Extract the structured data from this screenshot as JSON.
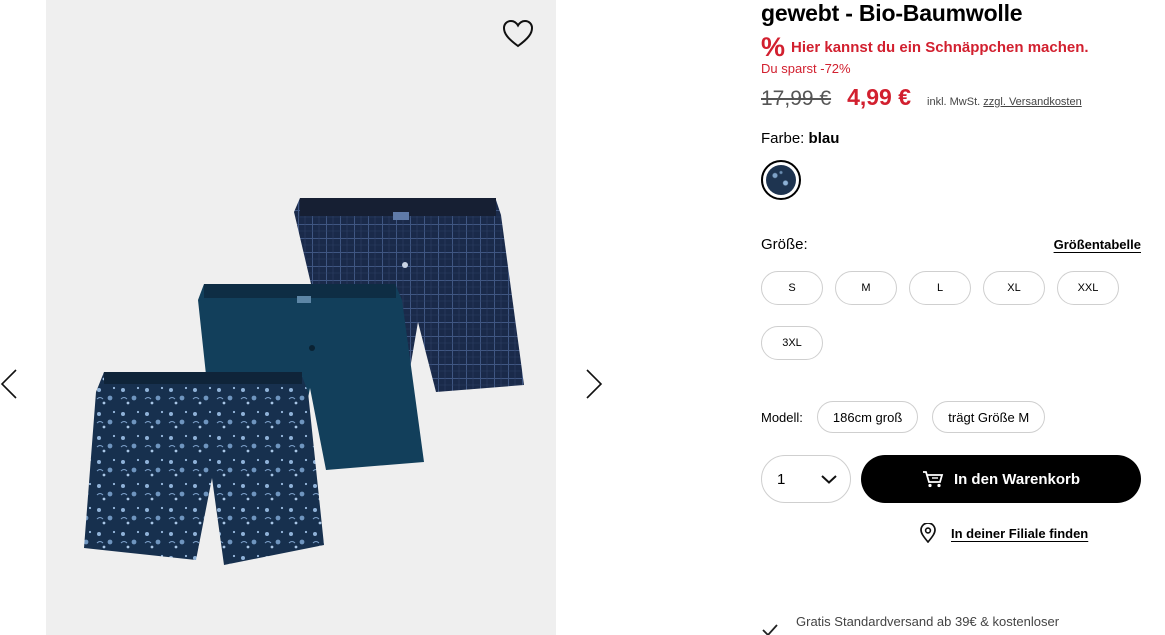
{
  "product": {
    "title_partial": "gewebt - Bio-Baumwolle",
    "deal_symbol": "%",
    "deal_text": "Hier kannst du ein Schnäppchen machen.",
    "savings": "Du sparst -72%",
    "old_price": "17,99 €",
    "new_price": "4,99 €",
    "vat_prefix": "inkl. MwSt.",
    "shipping_link": "zzgl. Versandkosten"
  },
  "color": {
    "label": "Farbe:",
    "value": "blau"
  },
  "size": {
    "label": "Größe:",
    "table_link": "Größentabelle",
    "options": [
      "S",
      "M",
      "L",
      "XL",
      "XXL",
      "3XL"
    ]
  },
  "model": {
    "label": "Modell:",
    "height": "186cm groß",
    "wears": "trägt Größe M"
  },
  "cart": {
    "quantity": "1",
    "button": "In den Warenkorb"
  },
  "store": {
    "link": "In deiner Filiale finden"
  },
  "shipping_info": "Gratis Standardversand ab 39€ & kostenloser",
  "icons": {
    "wishlist": "heart-icon",
    "prev": "chevron-left-icon",
    "next": "chevron-right-icon",
    "cart": "cart-icon",
    "location": "location-pin-icon",
    "check": "check-icon",
    "qty": "chevron-down-icon"
  },
  "colors": {
    "sale_red": "#d2202f",
    "button_black": "#000000",
    "gallery_bg": "#efefef"
  }
}
